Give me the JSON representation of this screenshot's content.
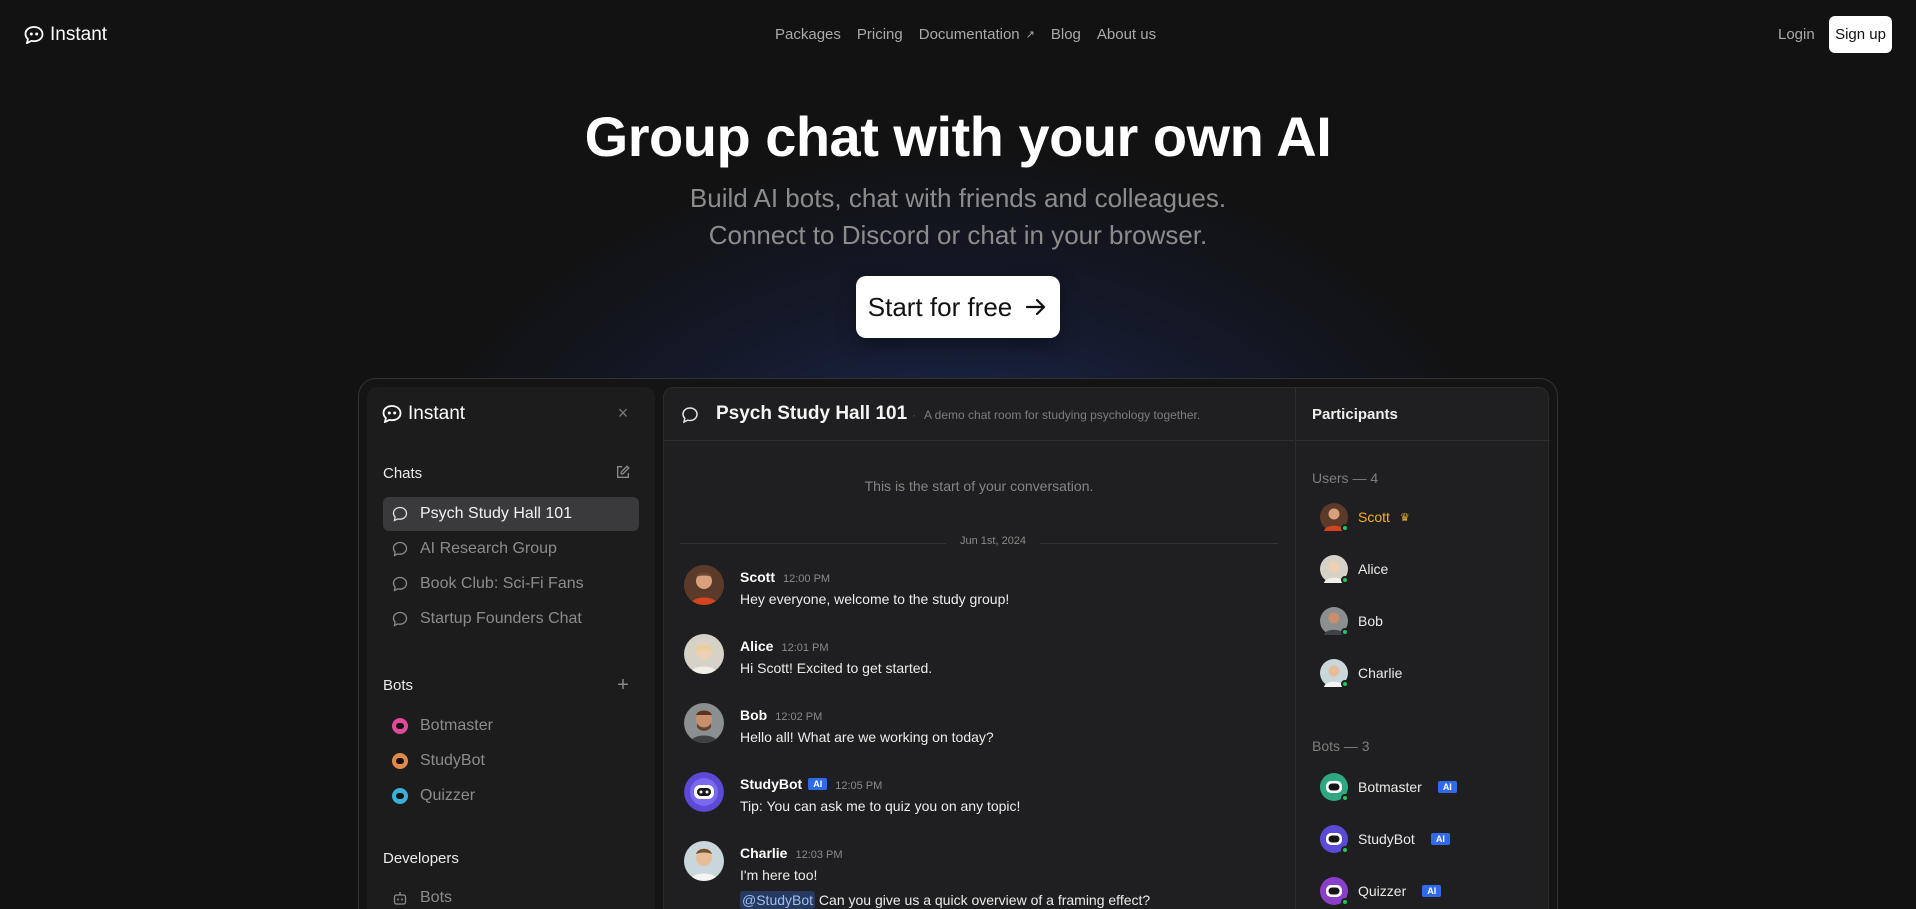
{
  "nav": {
    "brand": "Instant",
    "links": [
      "Packages",
      "Pricing",
      "Documentation",
      "Blog",
      "About us"
    ],
    "login": "Login",
    "signup": "Sign up"
  },
  "hero": {
    "title": "Group chat with your own AI",
    "subtitle_line1": "Build AI bots, chat with friends and colleagues.",
    "subtitle_line2": "Connect to Discord or chat in your browser.",
    "cta": "Start for free"
  },
  "sidebar": {
    "brand": "Instant",
    "chats_heading": "Chats",
    "chats": [
      "Psych Study Hall 101",
      "AI Research Group",
      "Book Club: Sci-Fi Fans",
      "Startup Founders Chat"
    ],
    "bots_heading": "Bots",
    "bots": [
      "Botmaster",
      "StudyBot",
      "Quizzer"
    ],
    "developers_heading": "Developers",
    "developers": [
      "Bots"
    ]
  },
  "chat": {
    "title": "Psych Study Hall 101",
    "description": "A demo chat room for studying psychology together.",
    "start_note": "This is the start of your conversation.",
    "date": "Jun 1st, 2024",
    "messages": [
      {
        "name": "Scott",
        "time": "12:00 PM",
        "text": "Hey everyone, welcome to the study group!"
      },
      {
        "name": "Alice",
        "time": "12:01 PM",
        "text": "Hi Scott! Excited to get started."
      },
      {
        "name": "Bob",
        "time": "12:02 PM",
        "text": "Hello all! What are we working on today?"
      },
      {
        "name": "StudyBot",
        "badge": "AI",
        "time": "12:05 PM",
        "text": "Tip: You can ask me to quiz you on any topic!"
      },
      {
        "name": "Charlie",
        "time": "12:03 PM",
        "text": "I'm here too!",
        "mention": "@StudyBot",
        "text2": "Can you give us a quick overview of a framing effect?"
      }
    ]
  },
  "participants": {
    "heading": "Participants",
    "users_label": "Users — 4",
    "users": [
      "Scott",
      "Alice",
      "Bob",
      "Charlie"
    ],
    "bots_label": "Bots — 3",
    "bots": [
      "Botmaster",
      "StudyBot",
      "Quizzer"
    ],
    "ai_badge": "AI"
  },
  "colors": {
    "accent_blue": "#2f6be8",
    "online_green": "#22c55e",
    "owner_gold": "#f2b22b"
  }
}
